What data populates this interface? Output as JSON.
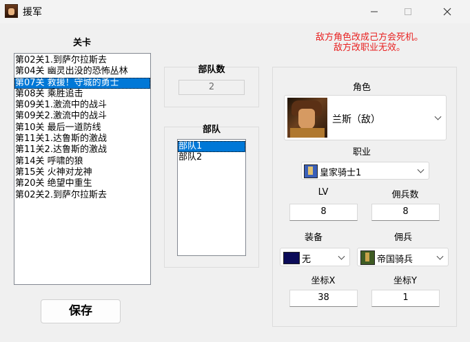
{
  "window": {
    "title": "援军",
    "minimize_icon": "minimize-icon",
    "maximize_icon": "maximize-icon",
    "close_icon": "close-icon"
  },
  "levels": {
    "header": "关卡",
    "items": [
      "第02关1.到萨尔拉斯去",
      "第04关 幽灵出没的恐怖丛林",
      "第07关 救援！守城的勇士",
      "第08关 乘胜追击",
      "第09关1.激流中的战斗",
      "第09关2.激流中的战斗",
      "第10关 最后一道防线",
      "第11关1.达鲁斯的激战",
      "第11关2.达鲁斯的激战",
      "第14关 呼啸的狼",
      "第15关 火神对龙神",
      "第20关 绝望中重生",
      "第02关2.到萨尔拉斯去"
    ],
    "selected_index": 2
  },
  "save_button": "保存",
  "troop_count": {
    "label": "部队数",
    "value": "2"
  },
  "troops": {
    "label": "部队",
    "items": [
      "部队1",
      "部队2"
    ],
    "selected_index": 0
  },
  "warning": {
    "line1": "敌方角色改成己方会死机。",
    "line2": "敌方改职业无效。"
  },
  "editor": {
    "role_label": "角色",
    "role_value": "兰斯（敌）",
    "job_label": "职业",
    "job_value": "皇家骑士1",
    "lv_label": "LV",
    "lv_value": "8",
    "merc_count_label": "佣兵数",
    "merc_count_value": "8",
    "equip_label": "装备",
    "equip_value": "无",
    "merc_label": "佣兵",
    "merc_value": "帝国骑兵",
    "x_label": "坐标X",
    "x_value": "38",
    "y_label": "坐标Y",
    "y_value": "1"
  },
  "colors": {
    "warning": "#e81f1f",
    "selection": "#0078d7",
    "equip_swatch": "#0b0b58"
  }
}
